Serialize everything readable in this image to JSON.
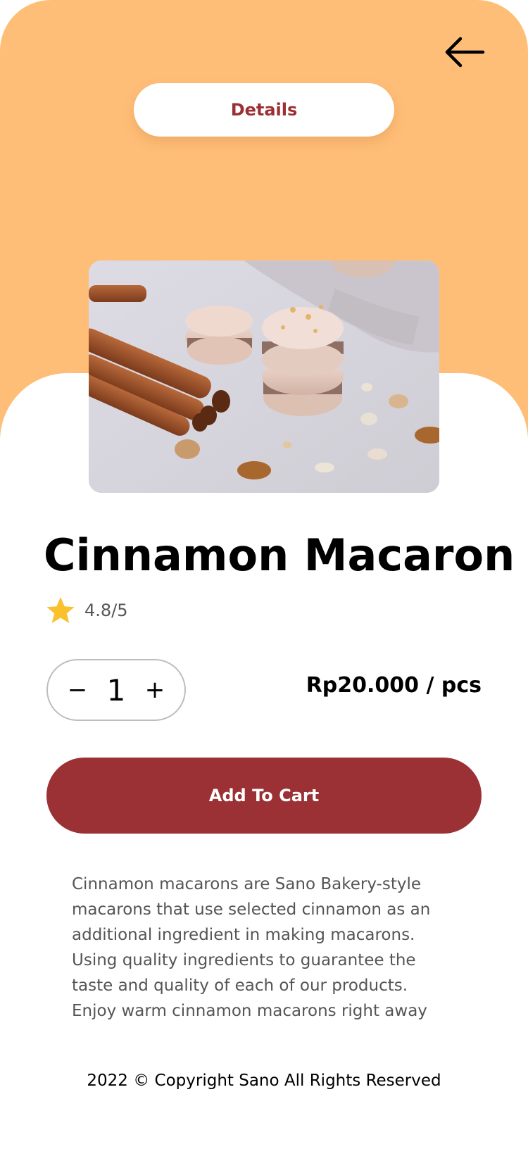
{
  "colors": {
    "header_bg": "#ffbe78",
    "accent": "#9b3135",
    "pill_text": "#9b2f33",
    "star": "#fbc02d"
  },
  "header": {
    "back_icon": "arrow-left-icon",
    "tab_label": "Details"
  },
  "product": {
    "image_alt": "cinnamon macarons",
    "title": "Cinnamon Macaron",
    "rating_icon": "star-icon",
    "rating": "4.8/5",
    "quantity": "1",
    "decrease_label": "−",
    "increase_label": "+",
    "price": "Rp20.000 / pcs",
    "add_to_cart": "Add To Cart",
    "description_lines": [
      "Cinnamon macarons are Sano Bakery-style",
      "macarons that use selected cinnamon as an",
      "additional ingredient in making macarons.",
      "Using quality ingredients to guarantee the",
      "taste and quality of each of our products.",
      "Enjoy warm cinnamon macarons right away"
    ]
  },
  "footer": {
    "copyright": "2022 © Copyright Sano All Rights Reserved"
  }
}
